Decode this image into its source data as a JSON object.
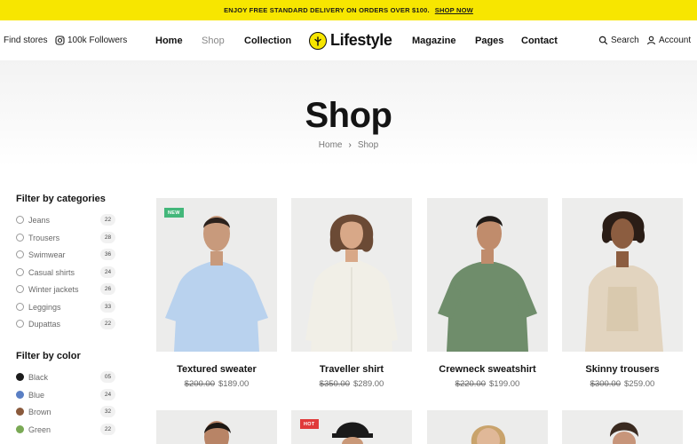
{
  "announcement": {
    "text": "ENJOY FREE STANDARD DELIVERY ON ORDERS OVER $100.",
    "cta": "SHOP NOW"
  },
  "header": {
    "find_stores": "Find stores",
    "followers": "100k Followers",
    "nav": [
      "Home",
      "Shop",
      "Collection",
      "Magazine",
      "Pages",
      "Contact"
    ],
    "logo": "Lifestyle",
    "search": "Search",
    "account": "Account"
  },
  "hero": {
    "title": "Shop",
    "breadcrumb": [
      "Home",
      "Shop"
    ],
    "separator": "›"
  },
  "sidebar": {
    "categories_title": "Filter by categories",
    "categories": [
      {
        "label": "Jeans",
        "count": "22"
      },
      {
        "label": "Trousers",
        "count": "28"
      },
      {
        "label": "Swimwear",
        "count": "36"
      },
      {
        "label": "Casual shirts",
        "count": "24"
      },
      {
        "label": "Winter jackets",
        "count": "26"
      },
      {
        "label": "Leggings",
        "count": "33"
      },
      {
        "label": "Dupattas",
        "count": "22"
      }
    ],
    "color_title": "Filter by color",
    "colors": [
      {
        "label": "Black",
        "count": "05",
        "swatch": "#1c1c1c"
      },
      {
        "label": "Blue",
        "count": "24",
        "swatch": "#5a7fc4"
      },
      {
        "label": "Brown",
        "count": "32",
        "swatch": "#8a5a3c"
      },
      {
        "label": "Green",
        "count": "22",
        "swatch": "#7aa955"
      }
    ]
  },
  "products": [
    {
      "name": "Textured sweater",
      "old_price": "$200.00",
      "price": "$189.00",
      "badge": "NEW",
      "shirt": "#b9d2ee"
    },
    {
      "name": "Traveller shirt",
      "old_price": "$350.00",
      "price": "$289.00",
      "badge": "",
      "shirt": "#f1efe7"
    },
    {
      "name": "Crewneck sweatshirt",
      "old_price": "$220.00",
      "price": "$199.00",
      "badge": "",
      "shirt": "#6f8d6b"
    },
    {
      "name": "Skinny trousers",
      "old_price": "$300.00",
      "price": "$259.00",
      "badge": "",
      "shirt": "#e2d4bf"
    }
  ],
  "second_row_badge": "HOT",
  "colors": {
    "announcement_bg": "#f7e600",
    "new_badge": "#43b77a",
    "hot_badge": "#e03a3a"
  }
}
